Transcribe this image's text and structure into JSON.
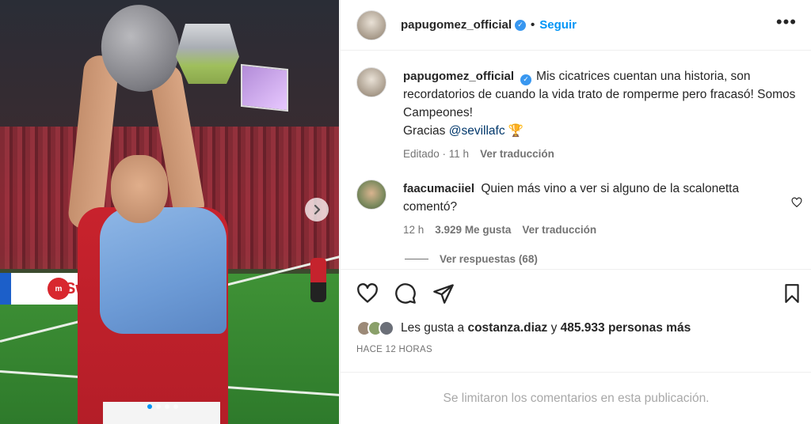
{
  "post": {
    "carousel": {
      "total_slides": 4,
      "current_slide": 1,
      "ad_board_text": "Swis"
    },
    "author": {
      "username": "papugomez_official",
      "verified": true
    },
    "header": {
      "separator": "•",
      "follow_label": "Seguir",
      "more_label": "•••"
    },
    "caption": {
      "username": "papugomez_official",
      "text_line": "Mis cicatrices cuentan una historia, son recordatorios de cuando la vida trato de romperme pero fracasó! Somos Campeones!",
      "thanks_prefix": "Gracias",
      "mention": "@sevillafc",
      "trophy_emoji": "🏆",
      "edited_label": "Editado",
      "time": "11 h",
      "translate_label": "Ver traducción"
    },
    "comments": [
      {
        "username": "faacumaciiel",
        "text": "Quien más vino a ver si alguno de la scalonetta comentó?",
        "time": "12 h",
        "likes": "3.929 Me gusta",
        "translate_label": "Ver traducción",
        "replies_label": "Ver respuestas (68)"
      }
    ],
    "likes_summary": {
      "prefix": "Les gusta a",
      "user": "costanza.diaz",
      "connector": "y",
      "others": "485.933 personas más"
    },
    "posted_ago": "HACE 12 HORAS",
    "comments_limited": "Se limitaron los comentarios en esta publicación."
  },
  "icons": [
    "heart-icon",
    "comment-icon",
    "share-icon",
    "bookmark-icon",
    "more-icon",
    "verified-icon",
    "chevron-right-icon"
  ],
  "colors": {
    "accent": "#0095f6",
    "text": "#262626",
    "muted": "#737373",
    "verified": "#3897f0",
    "mention": "#00376b"
  }
}
